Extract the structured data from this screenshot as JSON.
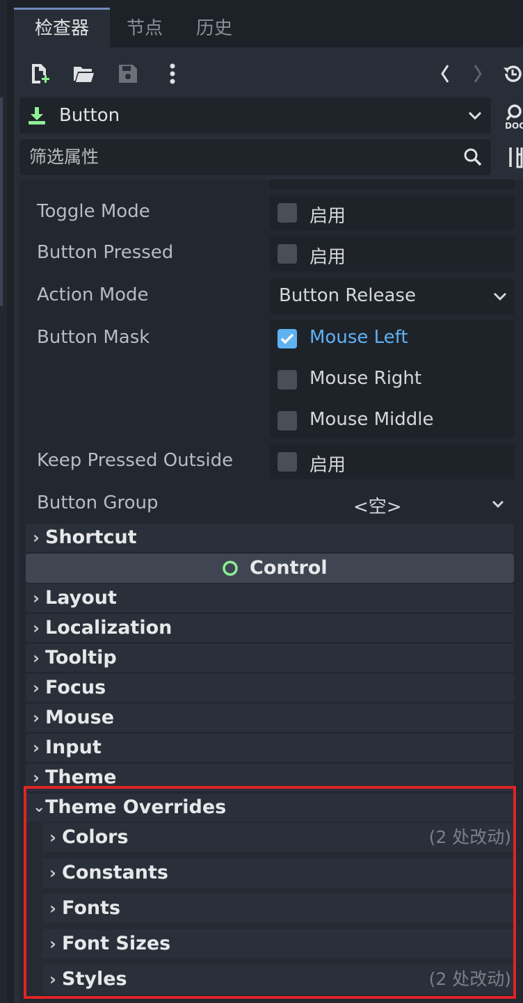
{
  "tabs": [
    "检查器",
    "节点",
    "历史"
  ],
  "toolbar": {
    "icons": [
      "new-resource-icon",
      "open-folder-icon",
      "save-icon",
      "more-vert-icon",
      "nav-back-icon",
      "nav-forward-icon",
      "history-icon"
    ]
  },
  "node": {
    "type": "Button",
    "doc_label": "DOC"
  },
  "filter": {
    "placeholder": "筛选属性"
  },
  "properties": {
    "toggle_mode": {
      "label": "Toggle Mode",
      "value_label": "启用",
      "checked": false
    },
    "button_pressed": {
      "label": "Button Pressed",
      "value_label": "启用",
      "checked": false
    },
    "action_mode": {
      "label": "Action Mode",
      "value": "Button Release"
    },
    "button_mask": {
      "label": "Button Mask",
      "options": [
        {
          "label": "Mouse Left",
          "checked": true
        },
        {
          "label": "Mouse Right",
          "checked": false
        },
        {
          "label": "Mouse Middle",
          "checked": false
        }
      ]
    },
    "keep_pressed_outside": {
      "label": "Keep Pressed Outside",
      "value_label": "启用",
      "checked": false
    },
    "button_group": {
      "label": "Button Group",
      "value": "<空>"
    }
  },
  "sections": {
    "shortcut": "Shortcut",
    "control_header": "Control",
    "groups": [
      "Layout",
      "Localization",
      "Tooltip",
      "Focus",
      "Mouse",
      "Input",
      "Theme"
    ],
    "theme_overrides": "Theme Overrides",
    "overrides": [
      {
        "label": "Colors",
        "count": "(2 处改动)"
      },
      {
        "label": "Constants",
        "count": ""
      },
      {
        "label": "Fonts",
        "count": ""
      },
      {
        "label": "Font Sizes",
        "count": ""
      },
      {
        "label": "Styles",
        "count": "(2 处改动)"
      }
    ]
  },
  "colors": {
    "accent": "#5fb2f2",
    "node_icon": "#8eef97",
    "highlight_box": "#e02424"
  }
}
